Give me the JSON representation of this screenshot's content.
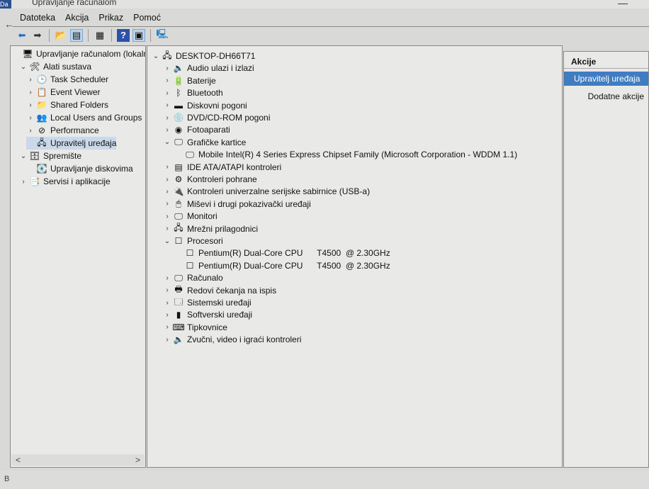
{
  "window": {
    "title": "Upravljanje računalom",
    "app_badge": "Da",
    "minimize": "—",
    "status": "B"
  },
  "menu": [
    "Datoteka",
    "Akcija",
    "Prikaz",
    "Pomoć"
  ],
  "toolbar": [
    "back-arrow",
    "forward-arrow",
    "up-folder",
    "show-hide-tree",
    "properties",
    "help",
    "show-action-pane",
    "computer-network"
  ],
  "left_tree": [
    {
      "label": "Upravljanje računalom (lokalno)",
      "level": 0,
      "chev": "",
      "icon": "🖥"
    },
    {
      "label": "Alati sustava",
      "level": 1,
      "chev": "⌄",
      "icon": "🛠"
    },
    {
      "label": "Task Scheduler",
      "level": 2,
      "chev": "›",
      "icon": "🕒"
    },
    {
      "label": "Event Viewer",
      "level": 2,
      "chev": "›",
      "icon": "📋"
    },
    {
      "label": "Shared Folders",
      "level": 2,
      "chev": "›",
      "icon": "📁"
    },
    {
      "label": "Local Users and Groups",
      "level": 2,
      "chev": "›",
      "icon": "👥"
    },
    {
      "label": "Performance",
      "level": 2,
      "chev": "›",
      "icon": "⊘"
    },
    {
      "label": "Upravitelj uređaja",
      "level": 2,
      "chev": "",
      "icon": "🖧",
      "selected": true
    },
    {
      "label": "Spremište",
      "level": 1,
      "chev": "⌄",
      "icon": "🗄"
    },
    {
      "label": "Upravljanje diskovima",
      "level": 2,
      "chev": "",
      "icon": "💽"
    },
    {
      "label": "Servisi i aplikacije",
      "level": 1,
      "chev": "›",
      "icon": "📑"
    }
  ],
  "device_tree": [
    {
      "label": "DESKTOP-DH66T71",
      "level": 0,
      "chev": "⌄",
      "icon": "🖧"
    },
    {
      "label": "Audio ulazi i izlazi",
      "level": 1,
      "chev": "›",
      "icon": "🔈"
    },
    {
      "label": "Baterije",
      "level": 1,
      "chev": "›",
      "icon": "🔋"
    },
    {
      "label": "Bluetooth",
      "level": 1,
      "chev": "›",
      "icon": "ᛒ"
    },
    {
      "label": "Diskovni pogoni",
      "level": 1,
      "chev": "›",
      "icon": "▬"
    },
    {
      "label": "DVD/CD-ROM pogoni",
      "level": 1,
      "chev": "›",
      "icon": "💿"
    },
    {
      "label": "Fotoaparati",
      "level": 1,
      "chev": "›",
      "icon": "◉"
    },
    {
      "label": "Grafičke kartice",
      "level": 1,
      "chev": "⌄",
      "icon": "🖵"
    },
    {
      "label": "Mobile Intel(R) 4 Series Express Chipset Family (Microsoft Corporation - WDDM 1.1)",
      "level": 2,
      "chev": "",
      "icon": "🖵"
    },
    {
      "label": "IDE ATA/ATAPI kontroleri",
      "level": 1,
      "chev": "›",
      "icon": "▤"
    },
    {
      "label": "Kontroleri pohrane",
      "level": 1,
      "chev": "›",
      "icon": "⚙"
    },
    {
      "label": "Kontroleri univerzalne serijske sabirnice (USB-a)",
      "level": 1,
      "chev": "›",
      "icon": "🔌"
    },
    {
      "label": "Miševi i drugi pokazivački uređaji",
      "level": 1,
      "chev": "›",
      "icon": "🖱"
    },
    {
      "label": "Monitori",
      "level": 1,
      "chev": "›",
      "icon": "🖵"
    },
    {
      "label": "Mrežni prilagodnici",
      "level": 1,
      "chev": "›",
      "icon": "🖧"
    },
    {
      "label": "Procesori",
      "level": 1,
      "chev": "⌄",
      "icon": "☐"
    },
    {
      "label": "Pentium(R) Dual-Core CPU      T4500  @ 2.30GHz",
      "level": 2,
      "chev": "",
      "icon": "☐"
    },
    {
      "label": "Pentium(R) Dual-Core CPU      T4500  @ 2.30GHz",
      "level": 2,
      "chev": "",
      "icon": "☐"
    },
    {
      "label": "Računalo",
      "level": 1,
      "chev": "›",
      "icon": "🖵"
    },
    {
      "label": "Redovi čekanja na ispis",
      "level": 1,
      "chev": "›",
      "icon": "🖶"
    },
    {
      "label": "Sistemski uređaji",
      "level": 1,
      "chev": "›",
      "icon": "🗔"
    },
    {
      "label": "Softverski uređaji",
      "level": 1,
      "chev": "›",
      "icon": "▮"
    },
    {
      "label": "Tipkovnice",
      "level": 1,
      "chev": "›",
      "icon": "⌨"
    },
    {
      "label": "Zvučni, video i igraći kontroleri",
      "level": 1,
      "chev": "›",
      "icon": "🔈"
    }
  ],
  "actions": {
    "header": "Akcije",
    "selected": "Upravitelj uređaja",
    "more": "Dodatne akcije"
  },
  "scroll": {
    "left": "<",
    "right": ">"
  }
}
